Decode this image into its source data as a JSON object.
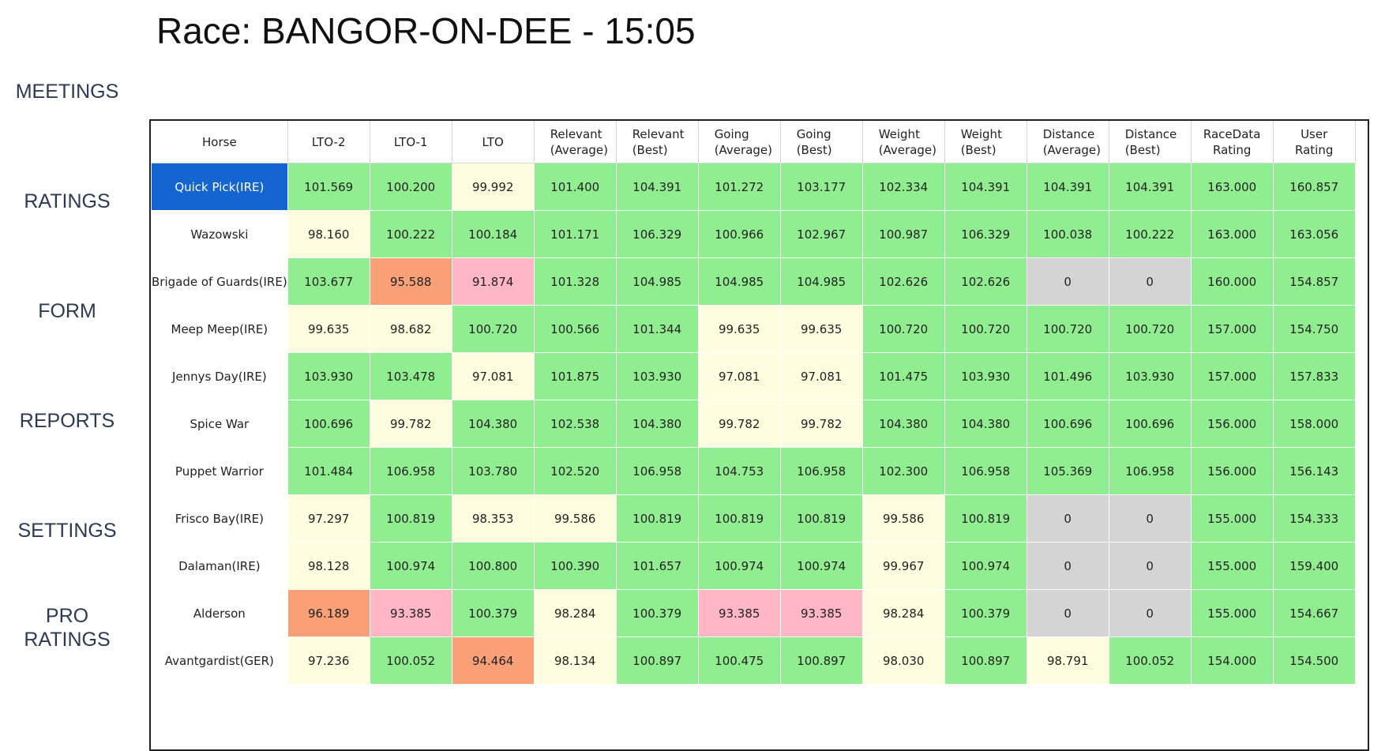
{
  "page": {
    "title": "Race: BANGOR-ON-DEE - 15:05"
  },
  "nav": {
    "items": [
      {
        "label": "MEETINGS"
      },
      {
        "label": "RATINGS"
      },
      {
        "label": "FORM"
      },
      {
        "label": "REPORTS"
      },
      {
        "label": "SETTINGS"
      },
      {
        "label_line1": "PRO",
        "label_line2": "RATINGS"
      }
    ]
  },
  "colors": {
    "green": "#90ee90",
    "cream": "#fffde0",
    "orange": "#f9a078",
    "pink": "#ffb6c5",
    "grey": "#d4d4d4",
    "selected": "#1464d2"
  },
  "table": {
    "headers": [
      {
        "line1": "Horse",
        "line2": ""
      },
      {
        "line1": "LTO-2",
        "line2": ""
      },
      {
        "line1": "LTO-1",
        "line2": ""
      },
      {
        "line1": "LTO",
        "line2": ""
      },
      {
        "line1": "Relevant",
        "line2": "(Average)"
      },
      {
        "line1": "Relevant",
        "line2": "(Best)"
      },
      {
        "line1": "Going",
        "line2": "(Average)"
      },
      {
        "line1": "Going",
        "line2": "(Best)"
      },
      {
        "line1": "Weight",
        "line2": "(Average)"
      },
      {
        "line1": "Weight",
        "line2": "(Best)"
      },
      {
        "line1": "Distance",
        "line2": "(Average)"
      },
      {
        "line1": "Distance",
        "line2": "(Best)"
      },
      {
        "line1": "RaceData",
        "line2": "Rating"
      },
      {
        "line1": "User",
        "line2": "Rating"
      }
    ],
    "selected_row": 0,
    "rows": [
      {
        "horse": "Quick Pick(IRE)",
        "values": [
          "101.569",
          "100.200",
          "99.992",
          "101.400",
          "104.391",
          "101.272",
          "103.177",
          "102.334",
          "104.391",
          "104.391",
          "104.391",
          "163.000",
          "160.857"
        ],
        "colors": [
          "green",
          "green",
          "cream",
          "green",
          "green",
          "green",
          "green",
          "green",
          "green",
          "green",
          "green",
          "green",
          "green"
        ]
      },
      {
        "horse": "Wazowski",
        "values": [
          "98.160",
          "100.222",
          "100.184",
          "101.171",
          "106.329",
          "100.966",
          "102.967",
          "100.987",
          "106.329",
          "100.038",
          "100.222",
          "163.000",
          "163.056"
        ],
        "colors": [
          "cream",
          "green",
          "green",
          "green",
          "green",
          "green",
          "green",
          "green",
          "green",
          "green",
          "green",
          "green",
          "green"
        ]
      },
      {
        "horse": "Brigade of Guards(IRE)",
        "values": [
          "103.677",
          "95.588",
          "91.874",
          "101.328",
          "104.985",
          "104.985",
          "104.985",
          "102.626",
          "102.626",
          "0",
          "0",
          "160.000",
          "154.857"
        ],
        "colors": [
          "green",
          "orange",
          "pink",
          "green",
          "green",
          "green",
          "green",
          "green",
          "green",
          "grey",
          "grey",
          "green",
          "green"
        ]
      },
      {
        "horse": "Meep Meep(IRE)",
        "values": [
          "99.635",
          "98.682",
          "100.720",
          "100.566",
          "101.344",
          "99.635",
          "99.635",
          "100.720",
          "100.720",
          "100.720",
          "100.720",
          "157.000",
          "154.750"
        ],
        "colors": [
          "cream",
          "cream",
          "green",
          "green",
          "green",
          "cream",
          "cream",
          "green",
          "green",
          "green",
          "green",
          "green",
          "green"
        ]
      },
      {
        "horse": "Jennys Day(IRE)",
        "values": [
          "103.930",
          "103.478",
          "97.081",
          "101.875",
          "103.930",
          "97.081",
          "97.081",
          "101.475",
          "103.930",
          "101.496",
          "103.930",
          "157.000",
          "157.833"
        ],
        "colors": [
          "green",
          "green",
          "cream",
          "green",
          "green",
          "cream",
          "cream",
          "green",
          "green",
          "green",
          "green",
          "green",
          "green"
        ]
      },
      {
        "horse": "Spice War",
        "values": [
          "100.696",
          "99.782",
          "104.380",
          "102.538",
          "104.380",
          "99.782",
          "99.782",
          "104.380",
          "104.380",
          "100.696",
          "100.696",
          "156.000",
          "158.000"
        ],
        "colors": [
          "green",
          "cream",
          "green",
          "green",
          "green",
          "cream",
          "cream",
          "green",
          "green",
          "green",
          "green",
          "green",
          "green"
        ]
      },
      {
        "horse": "Puppet Warrior",
        "values": [
          "101.484",
          "106.958",
          "103.780",
          "102.520",
          "106.958",
          "104.753",
          "106.958",
          "102.300",
          "106.958",
          "105.369",
          "106.958",
          "156.000",
          "156.143"
        ],
        "colors": [
          "green",
          "green",
          "green",
          "green",
          "green",
          "green",
          "green",
          "green",
          "green",
          "green",
          "green",
          "green",
          "green"
        ]
      },
      {
        "horse": "Frisco Bay(IRE)",
        "values": [
          "97.297",
          "100.819",
          "98.353",
          "99.586",
          "100.819",
          "100.819",
          "100.819",
          "99.586",
          "100.819",
          "0",
          "0",
          "155.000",
          "154.333"
        ],
        "colors": [
          "cream",
          "green",
          "cream",
          "cream",
          "green",
          "green",
          "green",
          "cream",
          "green",
          "grey",
          "grey",
          "green",
          "green"
        ]
      },
      {
        "horse": "Dalaman(IRE)",
        "values": [
          "98.128",
          "100.974",
          "100.800",
          "100.390",
          "101.657",
          "100.974",
          "100.974",
          "99.967",
          "100.974",
          "0",
          "0",
          "155.000",
          "159.400"
        ],
        "colors": [
          "cream",
          "green",
          "green",
          "green",
          "green",
          "green",
          "green",
          "cream",
          "green",
          "grey",
          "grey",
          "green",
          "green"
        ]
      },
      {
        "horse": "Alderson",
        "values": [
          "96.189",
          "93.385",
          "100.379",
          "98.284",
          "100.379",
          "93.385",
          "93.385",
          "98.284",
          "100.379",
          "0",
          "0",
          "155.000",
          "154.667"
        ],
        "colors": [
          "orange",
          "pink",
          "green",
          "cream",
          "green",
          "pink",
          "pink",
          "cream",
          "green",
          "grey",
          "grey",
          "green",
          "green"
        ]
      },
      {
        "horse": "Avantgardist(GER)",
        "values": [
          "97.236",
          "100.052",
          "94.464",
          "98.134",
          "100.897",
          "100.475",
          "100.897",
          "98.030",
          "100.897",
          "98.791",
          "100.052",
          "154.000",
          "154.500"
        ],
        "colors": [
          "cream",
          "green",
          "orange",
          "cream",
          "green",
          "green",
          "green",
          "cream",
          "green",
          "cream",
          "green",
          "green",
          "green"
        ]
      }
    ]
  }
}
